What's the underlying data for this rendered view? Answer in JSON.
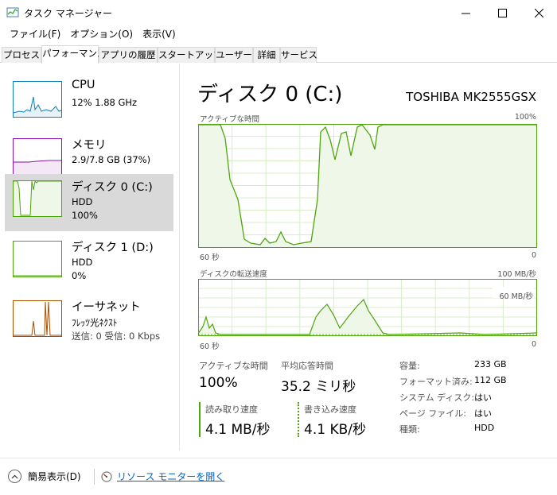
{
  "window": {
    "title": "タスク マネージャー"
  },
  "menu": [
    "ファイル(F)",
    "オプション(O)",
    "表示(V)"
  ],
  "tabs": [
    "プロセス",
    "パフォーマンス",
    "アプリの履歴",
    "スタートアップ",
    "ユーザー",
    "詳細",
    "サービス"
  ],
  "resources": [
    {
      "name": "CPU",
      "line1": "12%  1.88 GHz",
      "line2": ""
    },
    {
      "name": "メモリ",
      "line1": "2.9/7.8 GB (37%)",
      "line2": ""
    },
    {
      "name": "ディスク 0 (C:)",
      "line1": "HDD",
      "line2": "100%"
    },
    {
      "name": "ディスク 1 (D:)",
      "line1": "HDD",
      "line2": "0%"
    },
    {
      "name": "イーサネット",
      "line1": "ﾌﾚｯﾂ光ﾈｸｽﾄ",
      "line2": "送信: 0  受信: 0 Kbps"
    }
  ],
  "disk": {
    "title": "ディスク 0 (C:)",
    "model": "TOSHIBA MK2555GSX",
    "active_graph": {
      "label": "アクティブな時間",
      "max": "100%",
      "time_left": "60 秒",
      "time_right": "0"
    },
    "transfer_graph": {
      "label": "ディスクの転送速度",
      "max": "100 MB/秒",
      "mid": "60 MB/秒",
      "time_left": "60 秒",
      "time_right": "0"
    },
    "stats": {
      "active_label": "アクティブな時間",
      "active_value": "100%",
      "response_label": "平均応答時間",
      "response_value": "35.2 ミリ秒",
      "read_label": "読み取り速度",
      "read_value": "4.1 MB/秒",
      "write_label": "書き込み速度",
      "write_value": "4.1 KB/秒"
    },
    "props": [
      {
        "label": "容量:",
        "value": "233 GB"
      },
      {
        "label": "フォーマット済み:",
        "value": "112 GB"
      },
      {
        "label": "システム ディスク:",
        "value": "はい"
      },
      {
        "label": "ページ ファイル:",
        "value": "はい"
      },
      {
        "label": "種類:",
        "value": "HDD"
      }
    ]
  },
  "footer": {
    "simple_view": "簡易表示(D)",
    "resource_monitor": "リソース モニターを開く"
  },
  "colors": {
    "disk_line": "#4da60c",
    "disk_fill": "#eff7e8",
    "grid": "#d8ecc8",
    "cpu": "#117dbb",
    "mem": "#8b12ae",
    "net": "#a74f01"
  }
}
